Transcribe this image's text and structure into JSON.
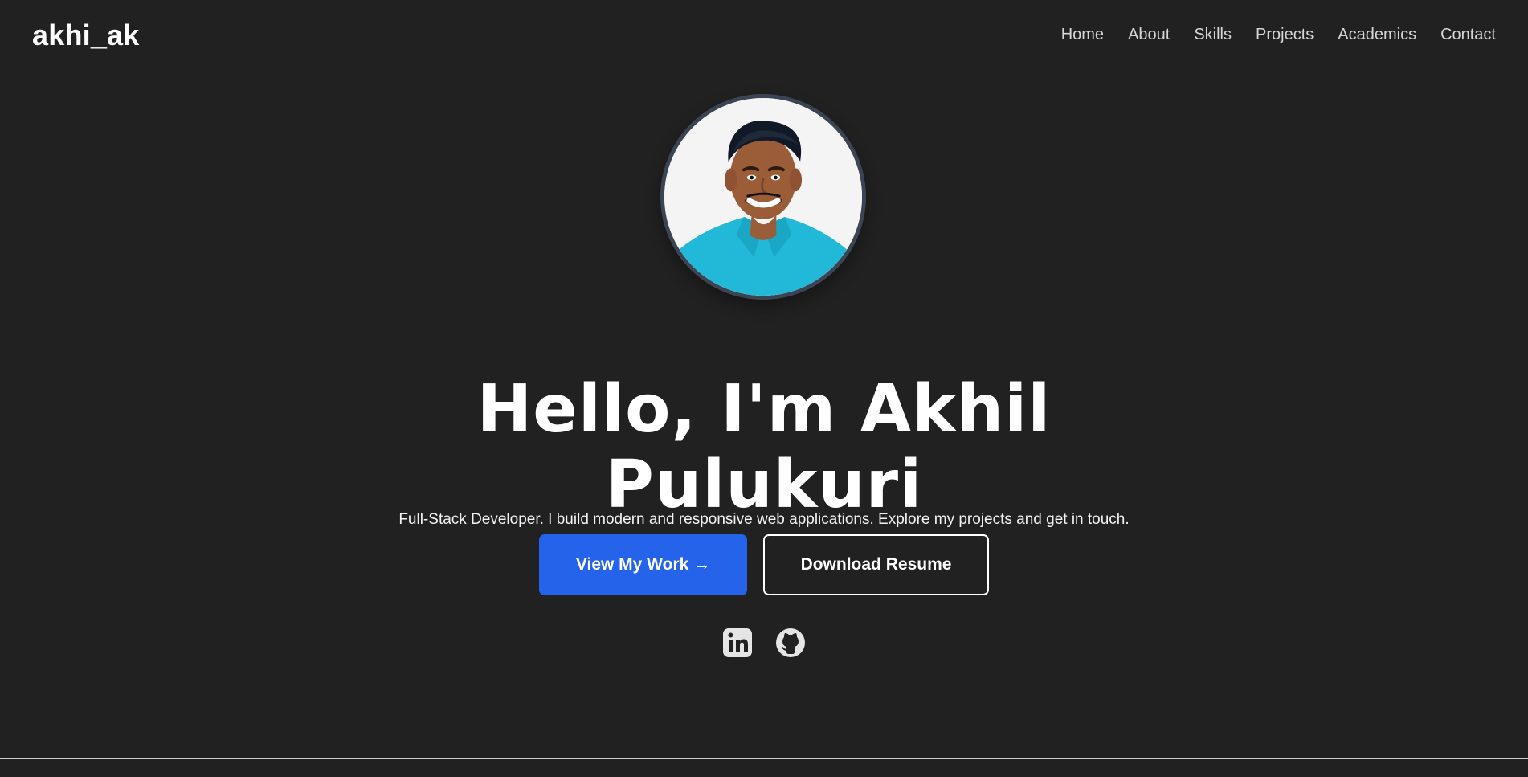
{
  "nav": {
    "brand": "akhi_ak",
    "links": [
      "Home",
      "About",
      "Skills",
      "Projects",
      "Academics",
      "Contact"
    ]
  },
  "hero": {
    "avatar_alt": "Profile photo of Akhil Pulukuri",
    "title_line_1": "Hello, I'm Akhil",
    "title_line_2": "Pulukuri",
    "subtitle": "Full-Stack Developer. I build modern and responsive web applications. Explore my projects and get in touch.",
    "primary_button": "View My Work →",
    "secondary_button": "Download Resume"
  },
  "social": {
    "linkedin_icon": "linkedin-icon",
    "github_icon": "github-icon"
  },
  "colors": {
    "background": "#212121",
    "text": "#ffffff",
    "nav_text": "#d6d6d6",
    "primary": "#2563eb",
    "avatar_border": "#3b4452",
    "divider": "#cfcfcf"
  }
}
